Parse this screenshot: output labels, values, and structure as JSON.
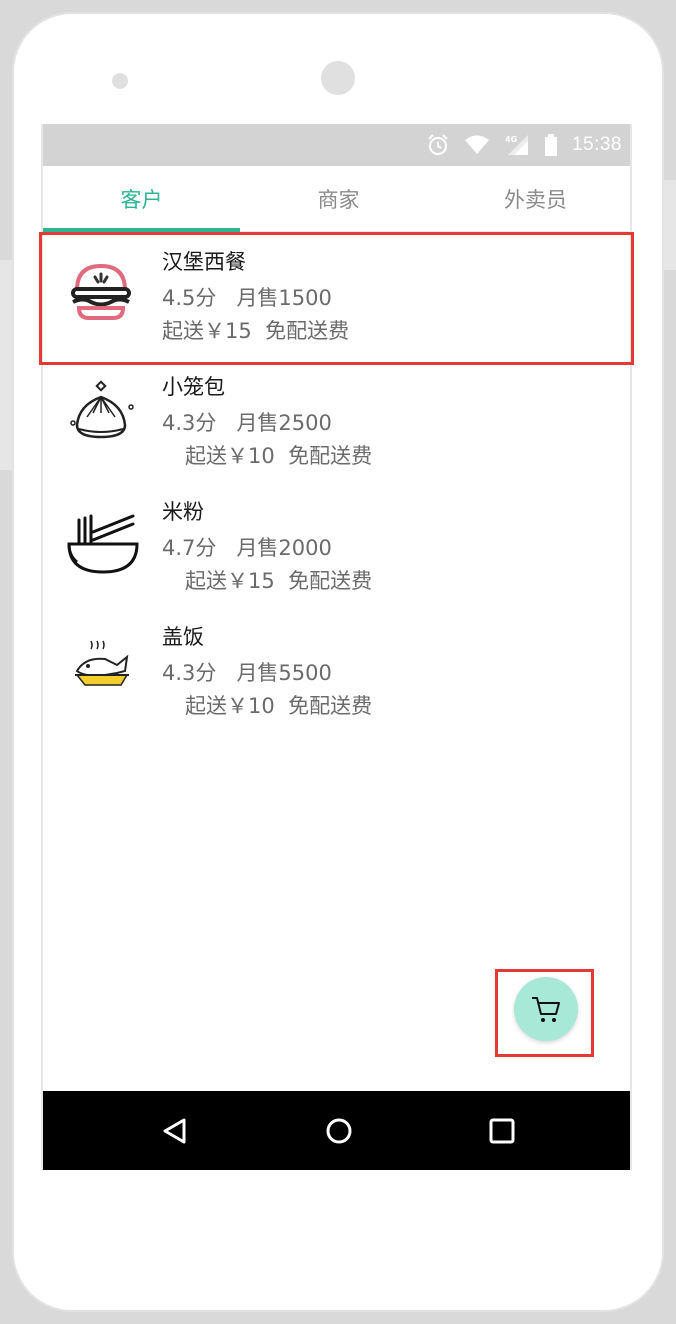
{
  "status_bar": {
    "time": "15:38",
    "icons": [
      "alarm-icon",
      "wifi-icon",
      "signal-4g-icon",
      "battery-icon"
    ]
  },
  "tabs": [
    {
      "label": "客户",
      "active": true
    },
    {
      "label": "商家",
      "active": false
    },
    {
      "label": "外卖员",
      "active": false
    }
  ],
  "restaurants": [
    {
      "name": "汉堡西餐",
      "rating": "4.5分",
      "monthly_sales": "月售1500",
      "min_order": "起送￥15",
      "delivery": "免配送费",
      "icon": "burger-icon"
    },
    {
      "name": "小笼包",
      "rating": "4.3分",
      "monthly_sales": "月售2500",
      "min_order": "起送￥10",
      "delivery": "免配送费",
      "icon": "dumpling-icon"
    },
    {
      "name": "米粉",
      "rating": "4.7分",
      "monthly_sales": "月售2000",
      "min_order": "起送￥15",
      "delivery": "免配送费",
      "icon": "noodle-bowl-icon"
    },
    {
      "name": "盖饭",
      "rating": "4.3分",
      "monthly_sales": "月售5500",
      "min_order": "起送￥10",
      "delivery": "免配送费",
      "icon": "rice-fish-icon"
    }
  ],
  "fab": {
    "icon": "cart-icon"
  },
  "nav": {
    "back_icon": "back-icon",
    "home_icon": "home-icon",
    "recents_icon": "recents-icon"
  },
  "colors": {
    "accent": "#2bb593",
    "fab_bg": "#a7e8d7",
    "highlight": "#e53935"
  }
}
